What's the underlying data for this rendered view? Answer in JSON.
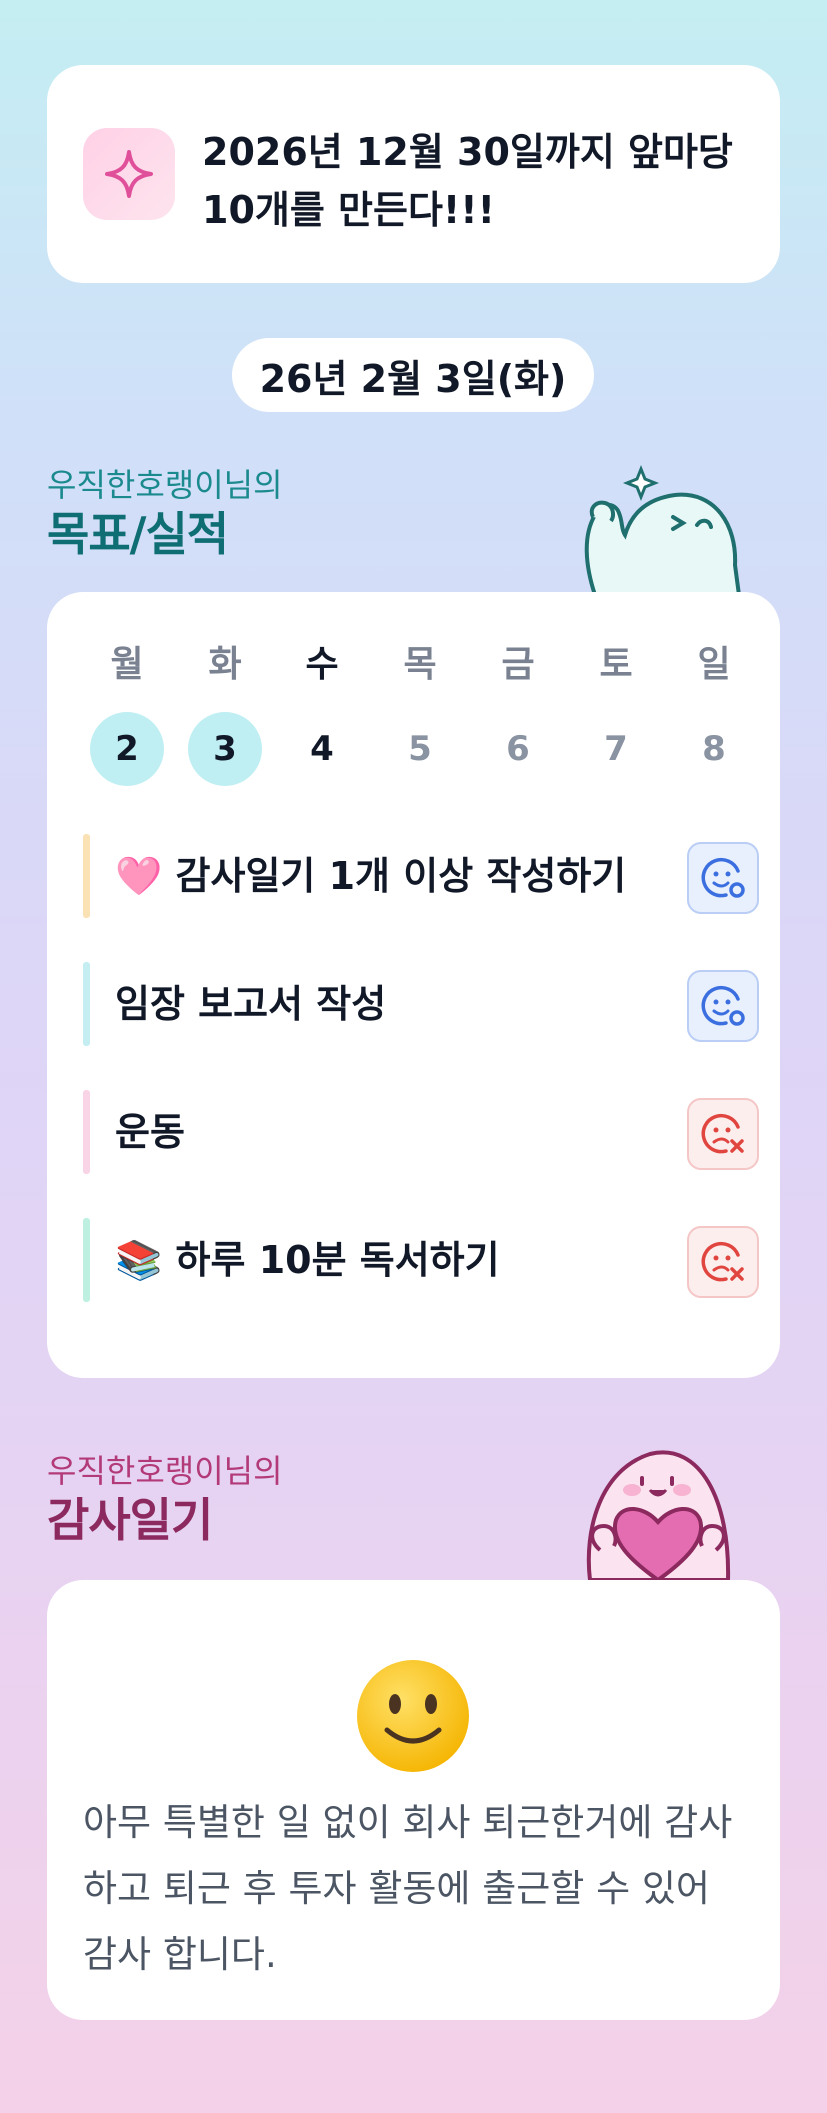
{
  "goal": {
    "icon": "sparkle-icon",
    "text": "2026년 12월 30일까지 앞마당 10개를 만든다!!!"
  },
  "date_label": "26년 2월 3일(화)",
  "goals_section": {
    "subtitle": "우직한호랭이님의",
    "title": "목표/실적"
  },
  "week": [
    {
      "name": "월",
      "num": "2",
      "state": "done"
    },
    {
      "name": "화",
      "num": "3",
      "state": "done"
    },
    {
      "name": "수",
      "num": "4",
      "state": "today"
    },
    {
      "name": "목",
      "num": "5",
      "state": "future"
    },
    {
      "name": "금",
      "num": "6",
      "state": "future"
    },
    {
      "name": "토",
      "num": "7",
      "state": "future"
    },
    {
      "name": "일",
      "num": "8",
      "state": "future"
    }
  ],
  "tasks": [
    {
      "label": "🩷 감사일기 1개 이상 작성하기",
      "bar_color": "#fbe2b4",
      "status": "done",
      "status_icon": "smile-check-icon"
    },
    {
      "label": "임장 보고서 작성",
      "bar_color": "#c4eef2",
      "status": "done",
      "status_icon": "smile-check-icon"
    },
    {
      "label": "운동",
      "bar_color": "#f9d3e6",
      "status": "failed",
      "status_icon": "frown-x-icon"
    },
    {
      "label": "📚 하루 10분 독서하기",
      "bar_color": "#bdf0e0",
      "status": "failed",
      "status_icon": "frown-x-icon"
    }
  ],
  "gratitude_section": {
    "subtitle": "우직한호랭이님의",
    "title": "감사일기"
  },
  "gratitude": {
    "emoji": "slightly-smiling-face-icon",
    "text": "아무 특별한 일 없이 회사 퇴근한거에 감사하고 퇴근 후 투자 활동에 출근할 수 있어 감사 합니다."
  },
  "colors": {
    "accent_teal": "#1b8a8e",
    "accent_plum": "#b33a79",
    "done_circle": "#bfeff3",
    "status_good": "#3b6fe0",
    "status_bad": "#e0463f"
  }
}
